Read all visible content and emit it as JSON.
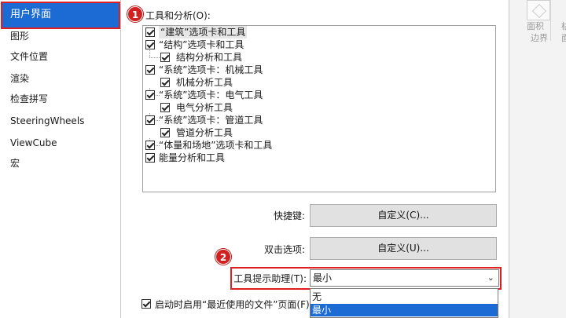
{
  "nav": {
    "items": [
      "用户界面",
      "图形",
      "文件位置",
      "渲染",
      "检查拼写",
      "SteeringWheels",
      "ViewCube",
      "宏"
    ]
  },
  "markers": [
    "1",
    "2"
  ],
  "tools": {
    "group_label": "工具和分析(O):",
    "items": [
      {
        "label": "“建筑”选项卡和工具",
        "checked": true,
        "level": 0
      },
      {
        "label": "“结构”选项卡和工具",
        "checked": true,
        "level": 0
      },
      {
        "label": "结构分析和工具",
        "checked": true,
        "level": 1
      },
      {
        "label": "“系统”选项卡：机械工具",
        "checked": true,
        "level": 0
      },
      {
        "label": "机械分析工具",
        "checked": true,
        "level": 1
      },
      {
        "label": "“系统”选项卡：电气工具",
        "checked": true,
        "level": 0
      },
      {
        "label": "电气分析工具",
        "checked": true,
        "level": 1
      },
      {
        "label": "“系统”选项卡：管道工具",
        "checked": true,
        "level": 0
      },
      {
        "label": "管道分析工具",
        "checked": true,
        "level": 1
      },
      {
        "label": "“体量和场地”选项卡和工具",
        "checked": true,
        "level": 0
      },
      {
        "label": "能量分析和工具",
        "checked": true,
        "level": 0
      }
    ]
  },
  "shortcuts": {
    "label": "快捷键:",
    "button": "自定义(C)..."
  },
  "double_click": {
    "label": "双击选项:",
    "button": "自定义(U)..."
  },
  "tooltip": {
    "label": "工具提示助理(T):",
    "value": "最小",
    "options": [
      "无",
      "最小"
    ],
    "selected": "最小"
  },
  "recent_files": {
    "label": "启动时启用“最近使用的文件”页面(F)",
    "checked": true
  },
  "ribbon": {
    "col1": [
      "面积",
      "边界"
    ],
    "col2": [
      "枯",
      "面"
    ]
  },
  "colors": {
    "accent": "#1c6bd4",
    "highlight": "#e02020"
  }
}
